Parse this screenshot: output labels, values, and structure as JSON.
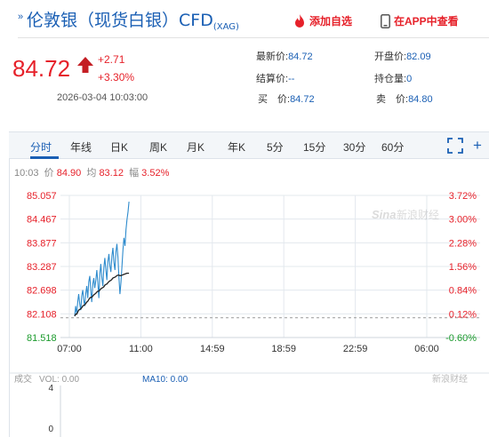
{
  "header": {
    "title": "伦敦银（现货白银）CFD",
    "code": "(XAG)",
    "add_favorite_label": "添加自选",
    "app_label": "在APP中查看"
  },
  "quote": {
    "price": "84.72",
    "change": "+2.71",
    "change_pct": "+3.30%",
    "datetime": "2026-03-04 10:03:00"
  },
  "stats": [
    {
      "label": "最新价:",
      "value": "84.72"
    },
    {
      "label": "开盘价:",
      "value": "82.09"
    },
    {
      "label": "结算价:",
      "value": "--"
    },
    {
      "label": "持仓量:",
      "value": "0"
    },
    {
      "label": "买　价:",
      "value": "84.72"
    },
    {
      "label": "卖　价:",
      "value": "84.80"
    }
  ],
  "tabs": [
    "分时",
    "年线",
    "日K",
    "周K",
    "月K",
    "年K",
    "5分",
    "15分",
    "30分",
    "60分"
  ],
  "active_tab": "分时",
  "info_bar": {
    "time": "10:03",
    "price_label": "价",
    "price": "84.90",
    "avg_label": "均",
    "avg": "83.12",
    "amp_label": "幅",
    "amp": "3.52%"
  },
  "watermark": "新浪财经",
  "volume_bar": {
    "label": "成交",
    "vol_text": "VOL: 0.00",
    "ma10_text": "MA10: 0.00"
  },
  "colors": {
    "up": "#e6212a",
    "blue": "#1a5fb4",
    "price_line": "#2e8bcd",
    "avg_line": "#222222",
    "down": "#1a9a2c"
  },
  "chart_data": {
    "type": "line",
    "ylim": [
      81.518,
      85.057
    ],
    "yticks": [
      "85.057",
      "84.467",
      "83.877",
      "83.287",
      "82.698",
      "82.108",
      "81.518"
    ],
    "pct_ticks": [
      "3.72%",
      "3.00%",
      "2.28%",
      "1.56%",
      "0.84%",
      "0.12%",
      "-0.60%"
    ],
    "x_labels": [
      "07:00",
      "11:00",
      "14:59",
      "18:59",
      "22:59",
      "06:00"
    ],
    "prev_close": 82.01,
    "volume_ticks": [
      "4",
      "0"
    ],
    "series": [
      {
        "values": [
          82.05,
          82.3,
          82.1,
          82.4,
          82.6,
          82.35,
          82.2,
          82.55,
          82.7,
          82.45,
          82.3,
          82.6,
          82.8,
          82.5,
          82.9,
          83.05,
          82.7,
          82.4,
          82.85,
          83.0,
          82.75,
          82.95,
          83.2,
          82.9,
          82.5,
          83.1,
          83.35,
          83.0,
          82.8,
          83.25,
          83.5,
          83.2,
          82.95,
          83.4,
          83.6,
          83.3,
          83.15,
          83.55,
          83.75,
          83.4,
          83.2,
          83.65,
          83.85,
          83.5,
          83.0,
          82.6,
          82.9,
          83.3,
          83.7,
          84.0,
          83.8,
          84.2,
          84.45,
          84.65,
          84.9
        ]
      },
      {
        "values": [
          82.05,
          82.1,
          82.1,
          82.15,
          82.2,
          82.22,
          82.23,
          82.26,
          82.3,
          82.32,
          82.33,
          82.36,
          82.4,
          82.42,
          82.46,
          82.5,
          82.52,
          82.52,
          82.55,
          82.58,
          82.6,
          82.62,
          82.65,
          82.67,
          82.67,
          82.7,
          82.73,
          82.75,
          82.76,
          82.78,
          82.82,
          82.84,
          82.85,
          82.88,
          82.91,
          82.93,
          82.94,
          82.97,
          83.0,
          83.01,
          83.02,
          83.04,
          83.06,
          83.07,
          83.07,
          83.06,
          83.06,
          83.07,
          83.08,
          83.09,
          83.1,
          83.11,
          83.12,
          83.12,
          83.12
        ]
      }
    ]
  }
}
